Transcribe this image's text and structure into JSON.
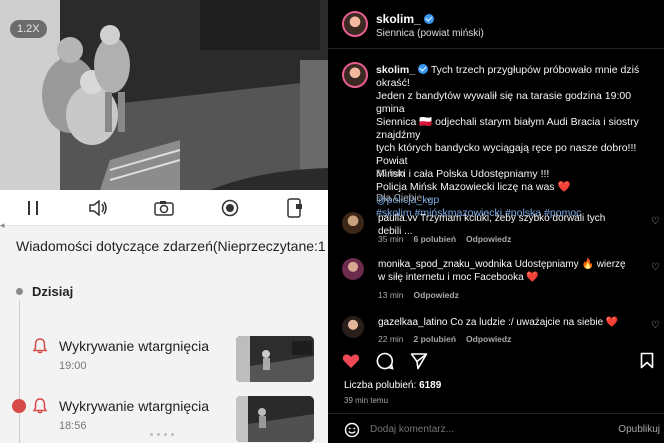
{
  "camera_app": {
    "zoom_level": "1.2X",
    "controls": [
      "pause-icon",
      "volume-icon",
      "camera-icon",
      "record-icon",
      "phone-icon"
    ],
    "events_title": "Wiadomości dotyczące zdarzeń(Nieprzeczytane:1",
    "day_label": "Dzisiaj",
    "events": [
      {
        "title": "Wykrywanie wtargnięcia",
        "time": "19:00"
      },
      {
        "title": "Wykrywanie wtargnięcia",
        "time": "18:56"
      }
    ]
  },
  "instagram": {
    "username": "skolim_",
    "location": "Siennica (powiat miński)",
    "caption": {
      "username": "skolim_",
      "text_lines": [
        "Tych trzech przygłupów próbowało mnie dziś okraść!",
        "Jeden z bandytów wywalił się na tarasie godzina 19:00 gmina",
        "Siennica 🇵🇱 odjechali starym białym Audi Bracia i siostry znajdźmy",
        "tych których bandycko wyciągają ręce po nasze dobro!!! Powiat",
        "Miński i cała Polska Udostępniamy !!!",
        "Policja Mińsk Mazowiecki liczę na was ❤️"
      ],
      "mention": "@policja_kgp",
      "hashtags": "#skolim #mińskmazowiecki #polska #pomoc",
      "time": "39 min"
    },
    "for_you_label": "Dla Ciebie ⌄",
    "comments": [
      {
        "user": "paulla.vv",
        "text": "Trzymam kciuki, żeby szybko dorwali tych debili ...",
        "time": "35 min",
        "likes": "6 polubień",
        "reply": "Odpowiedz"
      },
      {
        "user": "monika_spod_znaku_wodnika",
        "text": "Udostępniamy 🔥 wierzę w siłę internetu i moc Facebooka ❤️",
        "time": "13 min",
        "likes": "",
        "reply": "Odpowiedz"
      },
      {
        "user": "gazelkaa_latino",
        "text": "Co za ludzie :/ uważajcie na siebie ❤️",
        "time": "22 min",
        "likes": "2 polubień",
        "reply": "Odpowiedz"
      }
    ],
    "likes_label": "Liczba polubień:",
    "likes_count": "6189",
    "post_time": "39 min temu",
    "comment_placeholder": "Dodaj komentarz...",
    "publish_label": "Opublikuj",
    "colors": {
      "like_red": "#ed4956",
      "link_blue": "#7aa9e6",
      "verified_blue": "#3897f0"
    }
  }
}
